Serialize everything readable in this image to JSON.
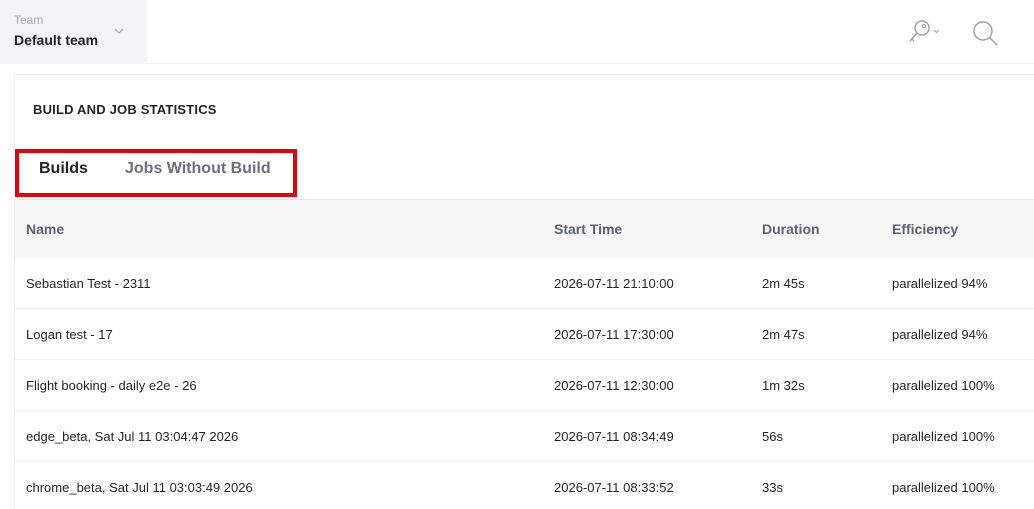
{
  "header": {
    "team_label": "Team",
    "team_name": "Default team",
    "icons": [
      "chevron-down-icon",
      "key-icon",
      "search-icon"
    ]
  },
  "card": {
    "title": "BUILD AND JOB STATISTICS"
  },
  "tabs": [
    {
      "label": "Builds",
      "active": true
    },
    {
      "label": "Jobs Without Build",
      "active": false
    }
  ],
  "table": {
    "columns": [
      "Name",
      "Start Time",
      "Duration",
      "Efficiency"
    ],
    "rows": [
      {
        "name": "Sebastian Test - 2311",
        "start": "2026-07-11 21:10:00",
        "duration": "2m 45s",
        "efficiency": "parallelized 94%"
      },
      {
        "name": "Logan test - 17",
        "start": "2026-07-11 17:30:00",
        "duration": "2m 47s",
        "efficiency": "parallelized 94%"
      },
      {
        "name": "Flight booking - daily e2e - 26",
        "start": "2026-07-11 12:30:00",
        "duration": "1m 32s",
        "efficiency": "parallelized 100%"
      },
      {
        "name": "edge_beta, Sat Jul 11 03:04:47 2026",
        "start": "2026-07-11 08:34:49",
        "duration": "56s",
        "efficiency": "parallelized 100%"
      },
      {
        "name": "chrome_beta, Sat Jul 11 03:03:49 2026",
        "start": "2026-07-11 08:33:52",
        "duration": "33s",
        "efficiency": "parallelized 100%"
      }
    ]
  },
  "colors": {
    "highlight": "#e8000b",
    "team_bg": "#f2f4f7",
    "header_bg": "#f6f7f9"
  }
}
